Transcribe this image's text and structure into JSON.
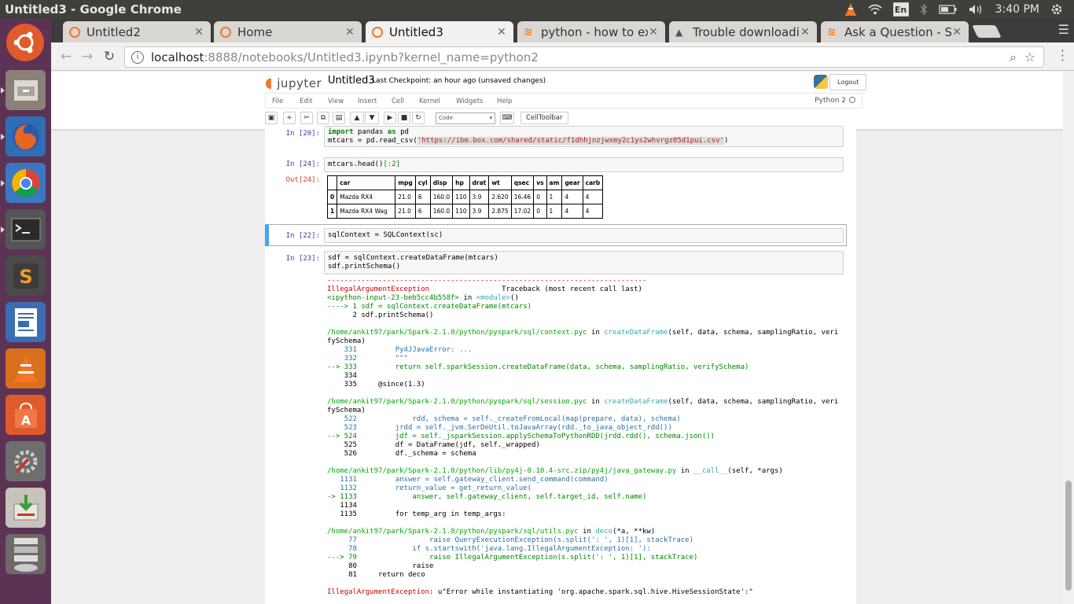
{
  "os": {
    "window_title": "Untitled3 - Google Chrome",
    "keyboard_layout": "En",
    "clock": "3:40 PM"
  },
  "launcher": {
    "items": [
      "ubuntu-dash",
      "files",
      "firefox",
      "chrome",
      "terminal",
      "sublime-text",
      "writer",
      "vlc",
      "software-center",
      "system-settings",
      "update-manager",
      "workspace-stack"
    ]
  },
  "browser": {
    "tabs": [
      {
        "label": "Untitled2",
        "icon": "jupyter"
      },
      {
        "label": "Home",
        "icon": "jupyter"
      },
      {
        "label": "Untitled3",
        "icon": "jupyter",
        "active": true
      },
      {
        "label": "python - how to ext",
        "icon": "stackoverflow"
      },
      {
        "label": "Trouble downloadin",
        "icon": "google-drive"
      },
      {
        "label": "Ask a Question - Sta",
        "icon": "stackoverflow"
      }
    ],
    "url_host": "localhost",
    "url_path": ":8888/notebooks/Untitled3.ipynb?kernel_name=python2"
  },
  "jupyter": {
    "logo_text": "jupyter",
    "notebook_name": "Untitled3",
    "checkpoint": "Last Checkpoint: an hour ago (unsaved changes)",
    "logout_label": "Logout",
    "menu": [
      "File",
      "Edit",
      "View",
      "Insert",
      "Cell",
      "Kernel",
      "Widgets",
      "Help"
    ],
    "kernel_name": "Python 2",
    "cell_type": "Code",
    "celltoolbar_label": "CellToolbar"
  },
  "cells": {
    "c20": {
      "prompt": "In [20]:",
      "line1_kw": "import",
      "line1_rest": " pandas ",
      "line1_kw2": "as",
      "line1_end": " pd",
      "line2_pre": "mtcars = pd.read_csv(",
      "line2_str": "'https://ibm.box.com/shared/static/f1dhhjnzjwxmy2c1ys2whvrgz05d1pui.csv'",
      "line2_end": ")"
    },
    "c24": {
      "prompt": "In [24]:",
      "code_pre": "mtcars.head()",
      "code_slice": "[:2]",
      "out_prompt": "Out[24]:",
      "columns": [
        "",
        "car",
        "mpg",
        "cyl",
        "disp",
        "hp",
        "drat",
        "wt",
        "qsec",
        "vs",
        "am",
        "gear",
        "carb"
      ],
      "rows": [
        [
          "0",
          "Mazda RX4",
          "21.0",
          "6",
          "160.0",
          "110",
          "3.9",
          "2.620",
          "16.46",
          "0",
          "1",
          "4",
          "4"
        ],
        [
          "1",
          "Mazda RX4 Wag",
          "21.0",
          "6",
          "160.0",
          "110",
          "3.9",
          "2.875",
          "17.02",
          "0",
          "1",
          "4",
          "4"
        ]
      ]
    },
    "c22": {
      "prompt": "In [22]:",
      "code": "sqlContext = SQLContext(sc)"
    },
    "c23": {
      "prompt": "In [23]:",
      "code1": "sdf = sqlContext.createDataFrame(mtcars)",
      "code2": "sdf.printSchema()"
    }
  },
  "traceback": {
    "dashes": "---------------------------------------------------------------------------",
    "exc_name": "IllegalArgumentException",
    "tb_header": "                 Traceback (most recent call last)",
    "input_ref": "<ipython-input-23-beb5cc4b558f>",
    "in_word": " in ",
    "module": "<module>",
    "module_end": "()",
    "l1": "----> 1 sdf = sqlContext.createDataFrame(mtcars)",
    "l2": "      2 sdf.printSchema()",
    "f1_path": "/home/ankit97/park/Spark-2.1.0/python/pyspark/sql/context.pyc",
    "f1_in": " in ",
    "f1_func": "createDataFrame",
    "f1_args": "(self, data, schema, samplingRatio, veri",
    "f1_args2": "fySchema)",
    "f1_lines": [
      "    331         Py4JJavaError: ...",
      "    332         \"\"\"",
      "--> 333         return self.sparkSession.createDataFrame(data, schema, samplingRatio, verifySchema)",
      "    334 ",
      "    335     @since(1.3)"
    ],
    "f2_path": "/home/ankit97/park/Spark-2.1.0/python/pyspark/sql/session.pyc",
    "f2_in": " in ",
    "f2_func": "createDataFrame",
    "f2_args": "(self, data, schema, samplingRatio, veri",
    "f2_args2": "fySchema)",
    "f2_lines": [
      "    522             rdd, schema = self._createFromLocal(map(prepare, data), schema)",
      "    523         jrdd = self._jvm.SerDeUtil.toJavaArray(rdd._to_java_object_rdd())",
      "--> 524         jdf = self._jsparkSession.applySchemaToPythonRDD(jrdd.rdd(), schema.json())",
      "    525         df = DataFrame(jdf, self._wrapped)",
      "    526         df._schema = schema"
    ],
    "f3_path": "/home/ankit97/park/Spark-2.1.0/python/lib/py4j-0.10.4-src.zip/py4j/java_gateway.py",
    "f3_in": " in ",
    "f3_func": "__call__",
    "f3_args": "(self, *args)",
    "f3_lines": [
      "   1131         answer = self.gateway_client.send_command(command)",
      "   1132         return_value = get_return_value(",
      "-> 1133             answer, self.gateway_client, self.target_id, self.name)",
      "   1134 ",
      "   1135         for temp_arg in temp_args:"
    ],
    "f4_path": "/home/ankit97/park/Spark-2.1.0/python/pyspark/sql/utils.pyc",
    "f4_in": " in ",
    "f4_func": "deco",
    "f4_args": "(*a, **kw)",
    "f4_lines": [
      "     77                 raise QueryExecutionException(s.split(': ', 1)[1], stackTrace)",
      "     78             if s.startswith('java.lang.IllegalArgumentException: '):",
      "---> 79                 raise IllegalArgumentException(s.split(': ', 1)[1], stackTrace)",
      "     80             raise",
      "     81     return deco"
    ],
    "final_name": "IllegalArgumentException",
    "final_msg": ": u\"Error while instantiating 'org.apache.spark.sql.hive.HiveSessionState':\""
  }
}
